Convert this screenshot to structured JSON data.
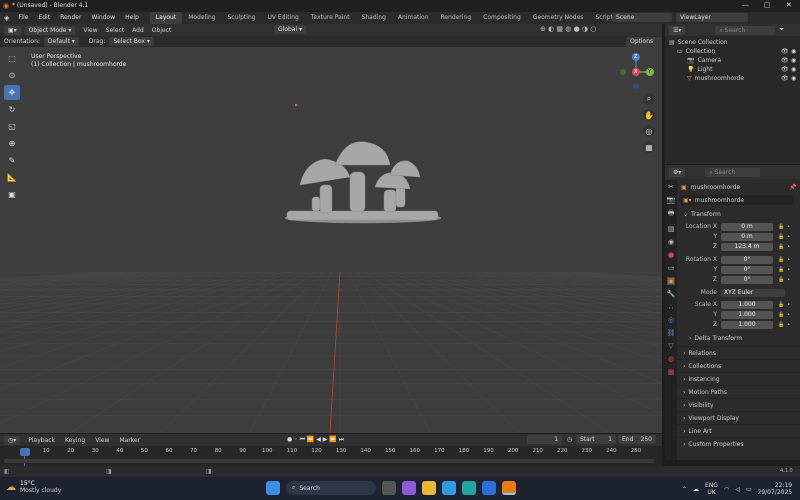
{
  "titlebar": {
    "title": "* (Unsaved) - Blender 4.1"
  },
  "menubar": {
    "menus": [
      "File",
      "Edit",
      "Render",
      "Window",
      "Help"
    ],
    "workspaces": [
      "Layout",
      "Modeling",
      "Sculpting",
      "UV Editing",
      "Texture Paint",
      "Shading",
      "Animation",
      "Rendering",
      "Compositing",
      "Geometry Nodes",
      "Scripting"
    ],
    "add": "+",
    "scene": "Scene",
    "view_layer": "ViewLayer"
  },
  "viewport_header": {
    "mode": "Object Mode",
    "menus": [
      "View",
      "Select",
      "Add",
      "Object"
    ],
    "transform": "Global",
    "orientation_label": "Orientation:",
    "orientation_value": "Default",
    "drag_label": "Drag:",
    "drag_value": "Select Box",
    "options": "Options"
  },
  "viewport": {
    "perspective": "User Perspective",
    "collection_info": "(1) Collection | mushroomhorde",
    "gizmo": {
      "x": "X",
      "y": "Y",
      "z": "Z"
    }
  },
  "outliner": {
    "search_placeholder": "Search",
    "root": "Scene Collection",
    "items": [
      {
        "label": "Collection"
      },
      {
        "label": "Camera"
      },
      {
        "label": "Light"
      },
      {
        "label": "mushroomhorde"
      }
    ]
  },
  "properties": {
    "search_placeholder": "Search",
    "object_name": "mushroomhorde",
    "data_name": "mushroomhorde",
    "transform_title": "Transform",
    "location": {
      "label": "Location X",
      "y_label": "Y",
      "z_label": "Z",
      "x": "0 m",
      "y": "0 m",
      "z": "123.4 m"
    },
    "rotation": {
      "label": "Rotation X",
      "y_label": "Y",
      "z_label": "Z",
      "x": "0°",
      "y": "0°",
      "z": "0°"
    },
    "mode": {
      "label": "Mode",
      "value": "XYZ Euler"
    },
    "scale": {
      "label": "Scale X",
      "y_label": "Y",
      "z_label": "Z",
      "x": "1.000",
      "y": "1.000",
      "z": "1.000"
    },
    "delta": "Delta Transform",
    "sections": [
      "Relations",
      "Collections",
      "Instancing",
      "Motion Paths",
      "Visibility",
      "Viewport Display",
      "Line Art",
      "Custom Properties"
    ]
  },
  "timeline": {
    "menus": [
      "Playback",
      "Keying",
      "View",
      "Marker"
    ],
    "current_frame": "1",
    "start_label": "Start",
    "start": "1",
    "end_label": "End",
    "end": "250",
    "ticks": [
      "1",
      "10",
      "20",
      "30",
      "40",
      "50",
      "60",
      "70",
      "80",
      "90",
      "100",
      "110",
      "120",
      "130",
      "140",
      "150",
      "160",
      "170",
      "180",
      "190",
      "200",
      "210",
      "220",
      "230",
      "240",
      "250"
    ]
  },
  "statusbar": {
    "version": "4.1.0"
  },
  "taskbar": {
    "weather_temp": "15°C",
    "weather_desc": "Mostly cloudy",
    "search": "Search",
    "lang1": "ENG",
    "lang2": "UK",
    "time": "22:19",
    "date": "29/07/2025"
  },
  "colors": {
    "accent": "#4772b3",
    "viewport_bg": "#3d3d3d",
    "taskbar": "#1c2230"
  }
}
